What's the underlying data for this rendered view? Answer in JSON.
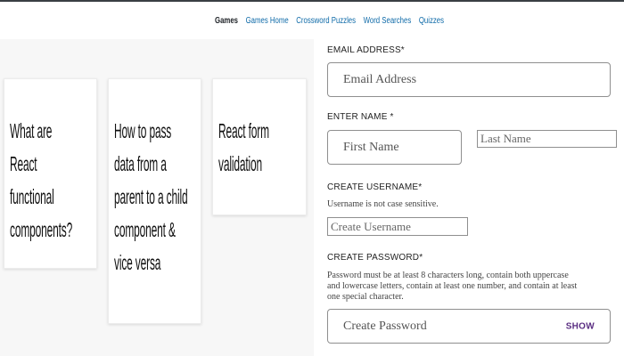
{
  "nav": {
    "items": [
      "Games",
      "Games Home",
      "Crossword Puzzles",
      "Word Searches",
      "Quizzes"
    ],
    "active_color": "#1f2328",
    "link_color": "#0e6aa8"
  },
  "cards": [
    {
      "title": "What are React functional components?"
    },
    {
      "title": "How to pass data from a parent to a child component & vice versa"
    },
    {
      "title": "React form validation"
    }
  ],
  "form": {
    "email": {
      "label": "EMAIL ADDRESS*",
      "placeholder": "Email Address"
    },
    "name": {
      "label": "ENTER NAME *",
      "first_placeholder": "First Name",
      "last_placeholder": "Last Name"
    },
    "username": {
      "label": "CREATE USERNAME*",
      "help": "Username is not case sensitive.",
      "placeholder": "Create Username"
    },
    "password": {
      "label": "CREATE PASSWORD*",
      "help_lines": [
        "Password must be at least 8 characters long, contain both uppercase",
        "and lowercase letters, contain at least one number, and contain at least",
        "one special character."
      ],
      "placeholder": "Create Password",
      "show_label": "SHOW"
    },
    "accent": "#5a2d82"
  }
}
